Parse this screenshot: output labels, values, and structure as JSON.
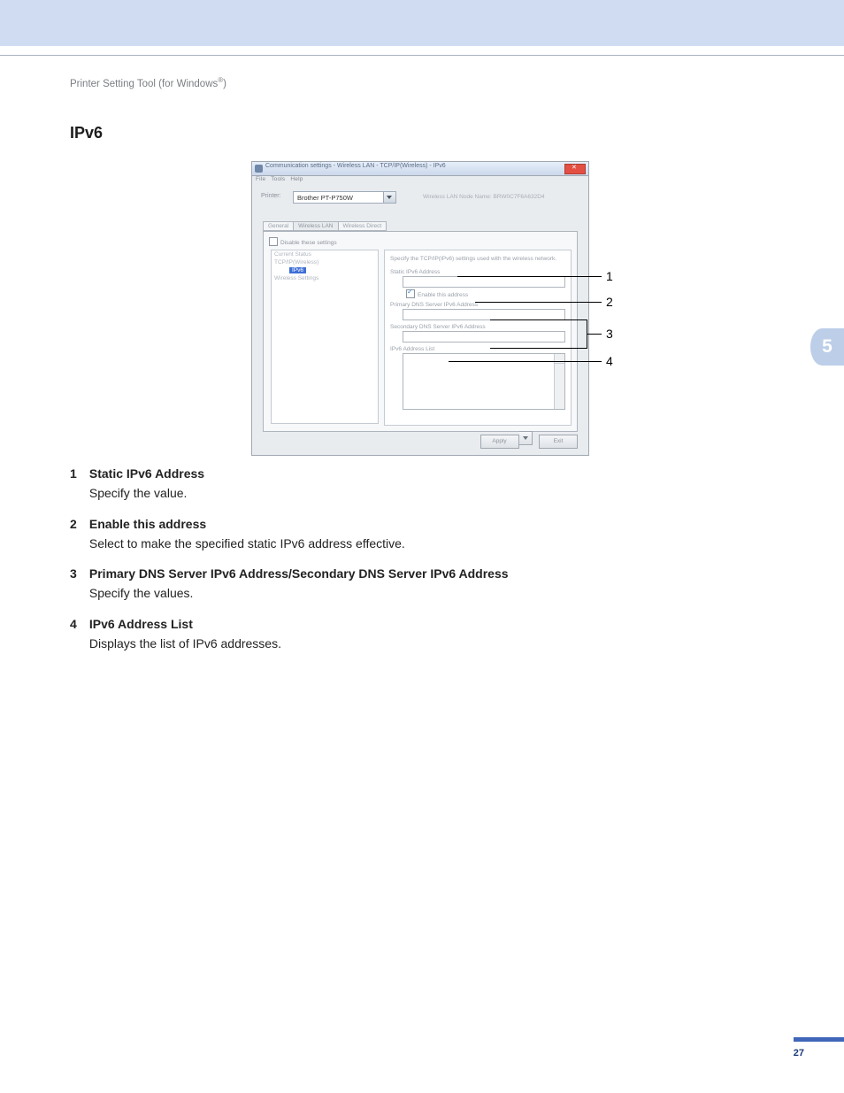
{
  "header": {
    "breadcrumb_prefix": "Printer Setting Tool (for Windows",
    "breadcrumb_suffix": ")",
    "reg_mark": "®"
  },
  "heading": "IPv6",
  "chapter_tab": "5",
  "page_number": "27",
  "screenshot": {
    "window_title": "Communication settings - Wireless LAN - TCP/IP(Wireless) - IPv6",
    "menu": {
      "file": "File",
      "tools": "Tools",
      "help": "Help"
    },
    "printer_label": "Printer:",
    "printer_value": "Brother PT-P750W",
    "node_info": "Wireless LAN Node Name: BRW0C7F6A632D4",
    "tabs": {
      "general": "General",
      "wireless_lan": "Wireless LAN",
      "wireless_direct": "Wireless Direct"
    },
    "disable_label": "Disable these settings",
    "tree": {
      "n0": "Current Status",
      "n1": "TCP/IP(Wireless)",
      "n2": "IPv6",
      "n3": "Wireless Settings"
    },
    "right": {
      "desc": "Specify the TCP/IP(IPv6) settings used with the wireless network.",
      "static_label": "Static IPv6 Address",
      "enable_label": "Enable this address",
      "primary_label": "Primary DNS Server IPv6 Address",
      "secondary_label": "Secondary DNS Server IPv6 Address",
      "list_label": "IPv6 Address List"
    },
    "buttons": {
      "apply": "Apply",
      "exit": "Exit"
    }
  },
  "callouts": {
    "c1": "1",
    "c2": "2",
    "c3": "3",
    "c4": "4"
  },
  "items": [
    {
      "num": "1",
      "term": "Static IPv6 Address",
      "desc": "Specify the value."
    },
    {
      "num": "2",
      "term": "Enable this address",
      "desc": "Select to make the specified static IPv6 address effective."
    },
    {
      "num": "3",
      "term": "Primary DNS Server IPv6 Address/Secondary DNS Server IPv6 Address",
      "desc": "Specify the values."
    },
    {
      "num": "4",
      "term": "IPv6 Address List",
      "desc": "Displays the list of IPv6 addresses."
    }
  ]
}
